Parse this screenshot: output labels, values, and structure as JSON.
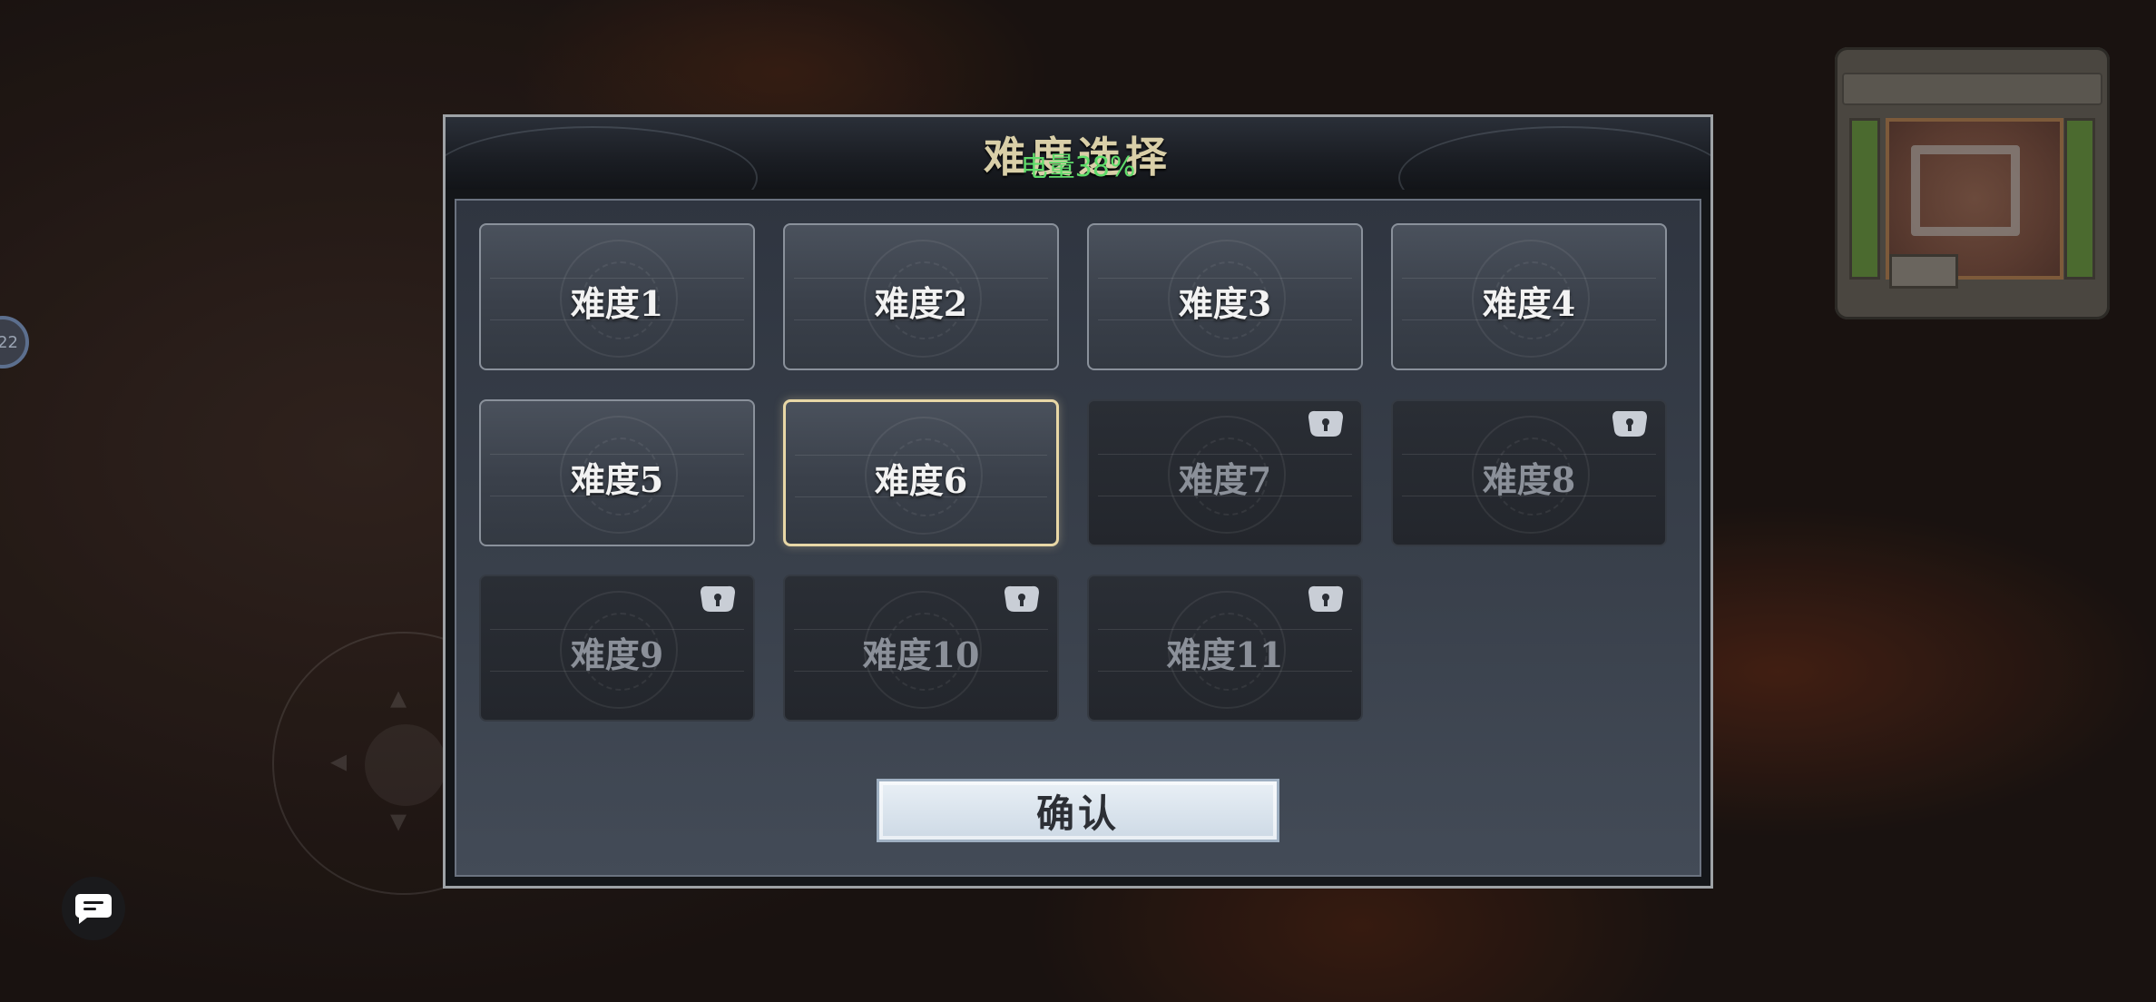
{
  "dialog": {
    "title": "难度选择",
    "confirm_label": "确认"
  },
  "status": {
    "battery": "电量38%"
  },
  "left_badge": {
    "text": "22"
  },
  "difficulties": [
    {
      "label": "难度1",
      "state": "unlocked"
    },
    {
      "label": "难度2",
      "state": "unlocked"
    },
    {
      "label": "难度3",
      "state": "unlocked"
    },
    {
      "label": "难度4",
      "state": "unlocked"
    },
    {
      "label": "难度5",
      "state": "unlocked"
    },
    {
      "label": "难度6",
      "state": "selected"
    },
    {
      "label": "难度7",
      "state": "locked"
    },
    {
      "label": "难度8",
      "state": "locked"
    },
    {
      "label": "难度9",
      "state": "locked"
    },
    {
      "label": "难度10",
      "state": "locked"
    },
    {
      "label": "难度11",
      "state": "locked"
    }
  ],
  "icons": {
    "lock": "lock-icon",
    "chat": "chat-icon"
  },
  "colors": {
    "selected_border": "#e8d7a6",
    "battery_text": "#5fdc6a",
    "confirm_bg": "#dbe5ee"
  }
}
